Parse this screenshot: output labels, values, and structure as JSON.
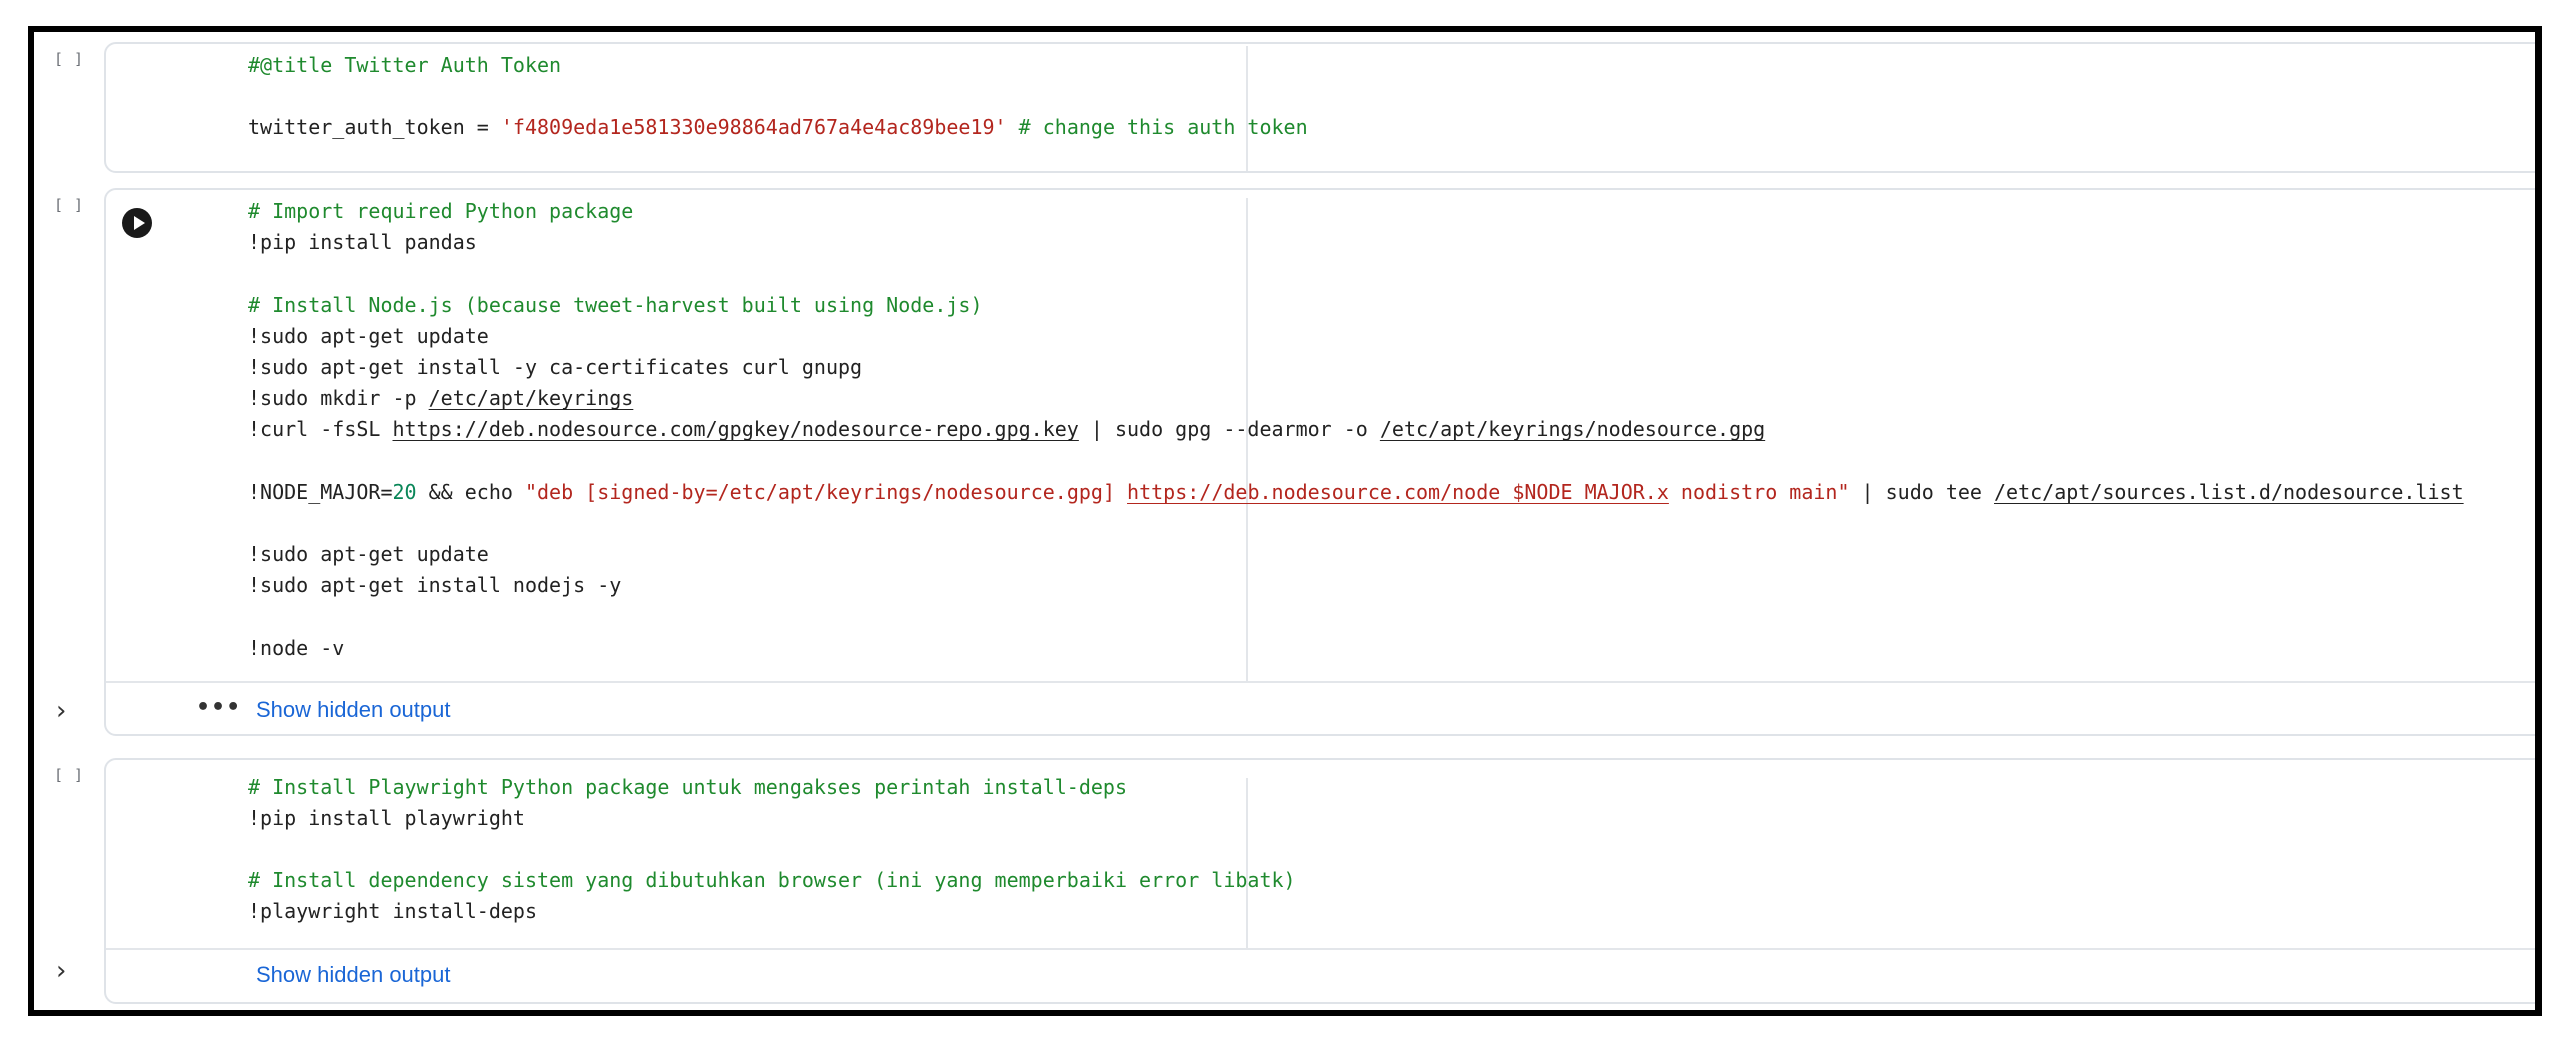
{
  "gutter_bracket": "[ ]",
  "cell1": {
    "lines": [
      [
        {
          "t": "#@title Twitter Auth Token",
          "c": "c"
        }
      ],
      [],
      [
        {
          "t": "twitter_auth_token = ",
          "c": "p"
        },
        {
          "t": "'f4809eda1e581330e98864ad767a4e4ac89bee19'",
          "c": "s"
        },
        {
          "t": " # change this auth token",
          "c": "c"
        }
      ]
    ]
  },
  "cell2": {
    "run_icon": "play-icon",
    "lines": [
      [
        {
          "t": "# Import required Python package",
          "c": "c"
        }
      ],
      [
        {
          "t": "!pip install pandas",
          "c": "p"
        }
      ],
      [],
      [
        {
          "t": "# Install Node.js (because tweet-harvest built using Node.js)",
          "c": "c"
        }
      ],
      [
        {
          "t": "!sudo apt-get update",
          "c": "p"
        }
      ],
      [
        {
          "t": "!sudo apt-get install -y ca-certificates curl gnupg",
          "c": "p"
        }
      ],
      [
        {
          "t": "!sudo mkdir -p ",
          "c": "p"
        },
        {
          "t": "/etc/apt/keyrings",
          "c": "p",
          "u": true
        }
      ],
      [
        {
          "t": "!curl -fsSL ",
          "c": "p"
        },
        {
          "t": "https://deb.nodesource.com/gpgkey/nodesource-repo.gpg.key",
          "c": "p",
          "u": true
        },
        {
          "t": " | sudo gpg --dearmor -o ",
          "c": "p"
        },
        {
          "t": "/etc/apt/keyrings/nodesource.gpg",
          "c": "p",
          "u": true
        }
      ],
      [],
      [
        {
          "t": "!NODE_MAJOR=",
          "c": "p"
        },
        {
          "t": "20",
          "c": "n"
        },
        {
          "t": " && echo ",
          "c": "p"
        },
        {
          "t": "\"deb [signed-by=/etc/apt/keyrings/nodesource.gpg] ",
          "c": "s"
        },
        {
          "t": "https://deb.nodesource.com/node_$NODE_MAJOR.x",
          "c": "s",
          "u": true
        },
        {
          "t": " nodistro main\"",
          "c": "s"
        },
        {
          "t": " | sudo tee ",
          "c": "p"
        },
        {
          "t": "/etc/apt/sources.list.d/nodesource.list",
          "c": "p",
          "u": true
        }
      ],
      [],
      [
        {
          "t": "!sudo apt-get update",
          "c": "p"
        }
      ],
      [
        {
          "t": "!sudo apt-get install nodejs -y",
          "c": "p"
        }
      ],
      [],
      [
        {
          "t": "!node -v",
          "c": "p"
        }
      ]
    ],
    "output": {
      "chevron": "›",
      "dots": "•••",
      "link": "Show hidden output"
    }
  },
  "cell3": {
    "lines": [
      [
        {
          "t": "# Install Playwright Python package untuk mengakses perintah install-deps",
          "c": "c"
        }
      ],
      [
        {
          "t": "!pip install playwright",
          "c": "p"
        }
      ],
      [],
      [
        {
          "t": "# Install dependency sistem yang dibutuhkan browser (ini yang memperbaiki error libatk)",
          "c": "c"
        }
      ],
      [
        {
          "t": "!playwright install-deps",
          "c": "p"
        }
      ]
    ],
    "output": {
      "chevron": "›",
      "link": "Show hidden output"
    }
  }
}
